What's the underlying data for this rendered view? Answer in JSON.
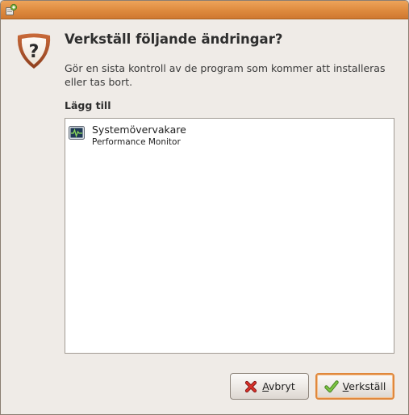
{
  "window": {
    "title": ""
  },
  "dialog": {
    "heading": "Verkställ följande ändringar?",
    "description": "Gör en sista kontroll av de program som kommer att installeras eller tas bort.",
    "icon": "question-shield-icon"
  },
  "section": {
    "label": "Lägg till"
  },
  "changes": {
    "items": [
      {
        "name": "Systemövervakare",
        "summary": "Performance Monitor",
        "icon": "system-monitor-icon"
      }
    ]
  },
  "buttons": {
    "cancel": {
      "mnemonic": "A",
      "rest": "vbryt",
      "icon": "red-x-icon"
    },
    "apply": {
      "mnemonic": "V",
      "rest": "erkställ",
      "icon": "green-check-icon"
    }
  },
  "colors": {
    "titlebar": "#de8a3e",
    "background": "#efebe7",
    "default_button_border": "#e0883c"
  }
}
